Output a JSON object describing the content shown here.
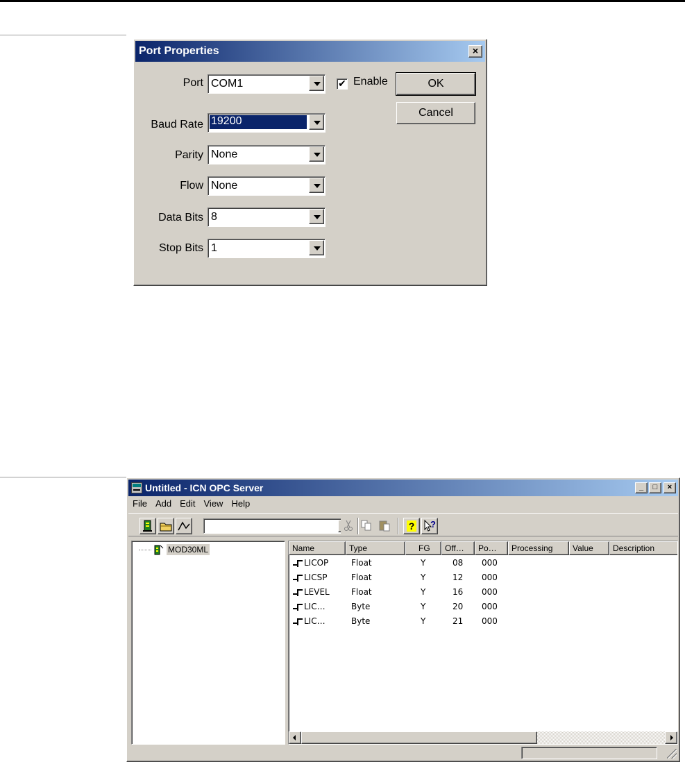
{
  "port_dialog": {
    "title": "Port Properties",
    "close_label": "×",
    "fields": {
      "port": {
        "label": "Port",
        "value": "COM1"
      },
      "baud_rate": {
        "label": "Baud Rate",
        "value": "19200"
      },
      "parity": {
        "label": "Parity",
        "value": "None"
      },
      "flow": {
        "label": "Flow",
        "value": "None"
      },
      "data_bits": {
        "label": "Data Bits",
        "value": "8"
      },
      "stop_bits": {
        "label": "Stop Bits",
        "value": "1"
      }
    },
    "enable": {
      "label": "Enable",
      "checked": true,
      "mark": "✔"
    },
    "ok_label": "OK",
    "cancel_label": "Cancel"
  },
  "opc_window": {
    "title": "Untitled - ICN OPC Server",
    "window_controls": {
      "minimize": "_",
      "maximize": "□",
      "close": "×"
    },
    "menu": [
      "File",
      "Add",
      "Edit",
      "View",
      "Help"
    ],
    "toolbar": {
      "combo_value": "",
      "icons": [
        "server-icon",
        "open-folder-icon",
        "trend-icon",
        "cut-icon",
        "copy-icon",
        "paste-icon",
        "help-icon",
        "context-help-icon"
      ],
      "help_glyph": "?",
      "context_help_glyph": "?"
    },
    "tree": {
      "node_label": "MOD30ML"
    },
    "list": {
      "columns": [
        "Name",
        "Type",
        "FG",
        "Off…",
        "Po…",
        "Processing",
        "Value",
        "Description"
      ],
      "rows": [
        {
          "name": "LICOP",
          "type": "Float",
          "fg": "Y",
          "offset": "08",
          "port": "000"
        },
        {
          "name": "LICSP",
          "type": "Float",
          "fg": "Y",
          "offset": "12",
          "port": "000"
        },
        {
          "name": "LEVEL",
          "type": "Float",
          "fg": "Y",
          "offset": "16",
          "port": "000"
        },
        {
          "name": "LIC…",
          "type": "Byte",
          "fg": "Y",
          "offset": "20",
          "port": "000"
        },
        {
          "name": "LIC…",
          "type": "Byte",
          "fg": "Y",
          "offset": "21",
          "port": "000"
        }
      ]
    },
    "colors": {
      "title_start": "#0a246a",
      "title_end": "#a6caf0",
      "face": "#d4d0c8"
    }
  }
}
